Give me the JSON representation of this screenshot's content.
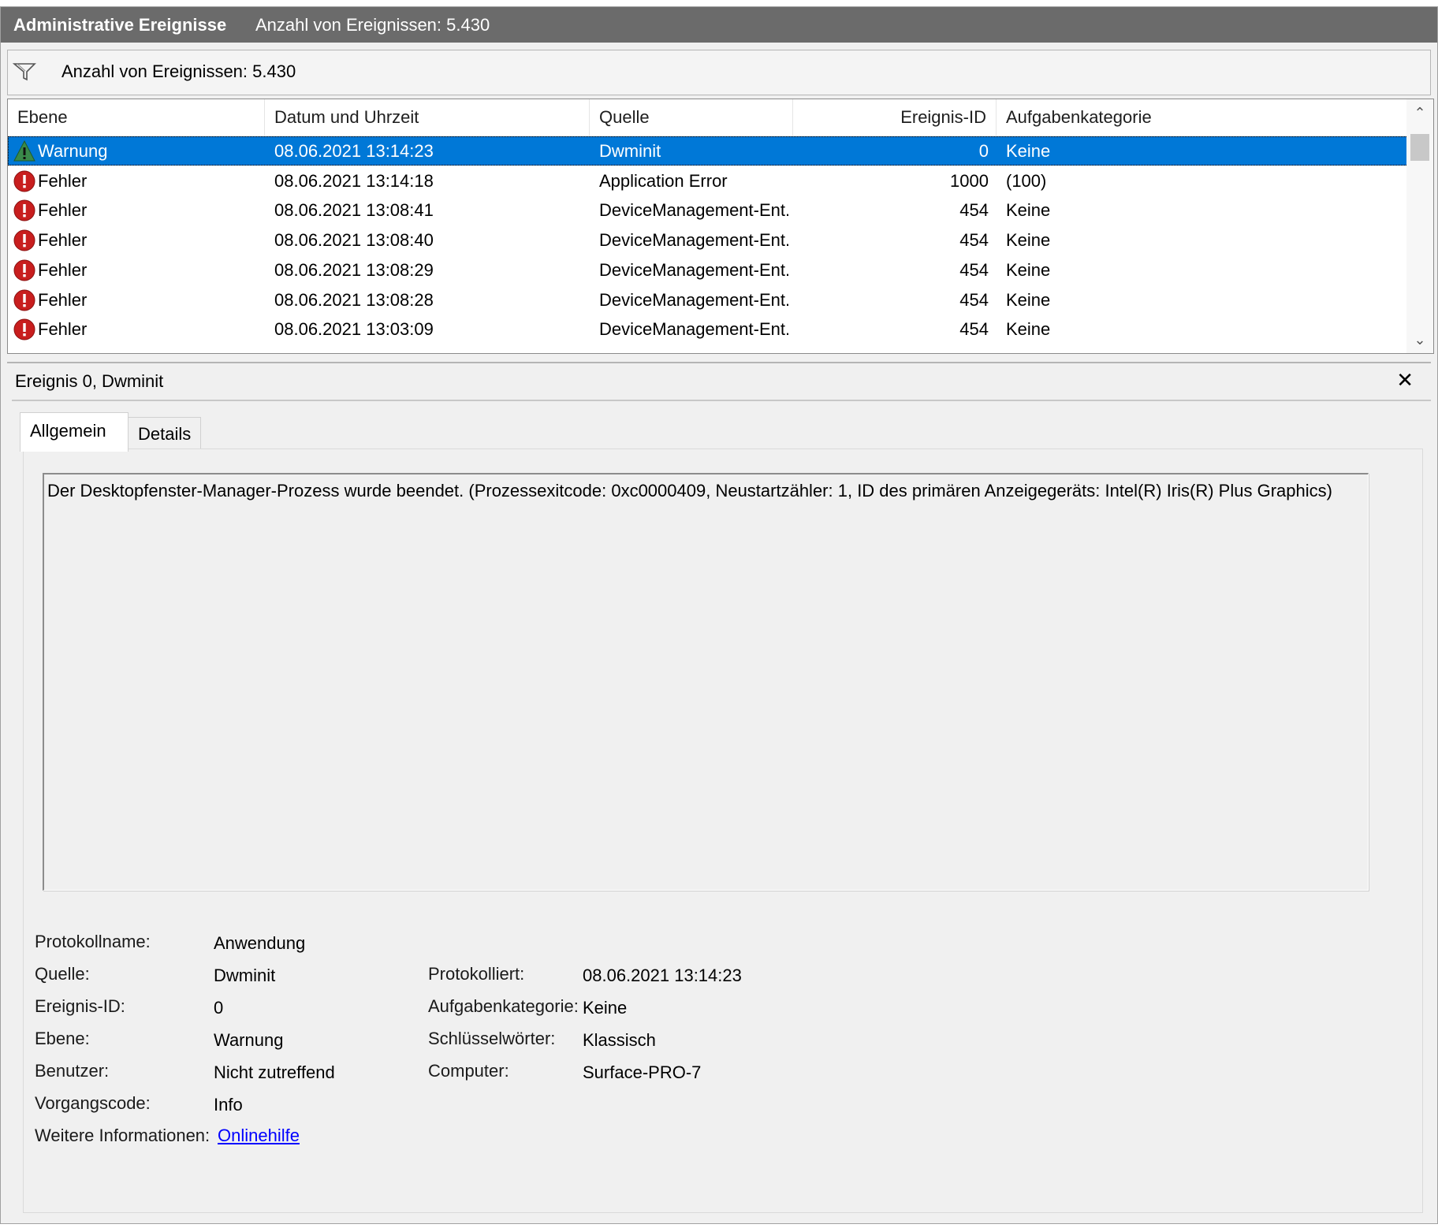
{
  "titlebar": {
    "title": "Administrative Ereignisse",
    "count": "Anzahl von Ereignissen: 5.430"
  },
  "filterbar": {
    "icon": "filter-funnel-icon",
    "text": "Anzahl von Ereignissen: 5.430"
  },
  "grid": {
    "columns": [
      "Ebene",
      "Datum und Uhrzeit",
      "Quelle",
      "Ereignis-ID",
      "Aufgabenkategorie"
    ],
    "rows": [
      {
        "level": "Warnung",
        "icon": "warning-icon",
        "datetime": "08.06.2021 13:14:23",
        "source": "Dwminit",
        "id": "0",
        "category": "Keine",
        "selected": true
      },
      {
        "level": "Fehler",
        "icon": "error-icon",
        "datetime": "08.06.2021 13:14:18",
        "source": "Application Error",
        "id": "1000",
        "category": "(100)",
        "selected": false
      },
      {
        "level": "Fehler",
        "icon": "error-icon",
        "datetime": "08.06.2021 13:08:41",
        "source": "DeviceManagement-Ent...",
        "id": "454",
        "category": "Keine",
        "selected": false
      },
      {
        "level": "Fehler",
        "icon": "error-icon",
        "datetime": "08.06.2021 13:08:40",
        "source": "DeviceManagement-Ent...",
        "id": "454",
        "category": "Keine",
        "selected": false
      },
      {
        "level": "Fehler",
        "icon": "error-icon",
        "datetime": "08.06.2021 13:08:29",
        "source": "DeviceManagement-Ent...",
        "id": "454",
        "category": "Keine",
        "selected": false
      },
      {
        "level": "Fehler",
        "icon": "error-icon",
        "datetime": "08.06.2021 13:08:28",
        "source": "DeviceManagement-Ent...",
        "id": "454",
        "category": "Keine",
        "selected": false
      },
      {
        "level": "Fehler",
        "icon": "error-icon",
        "datetime": "08.06.2021 13:03:09",
        "source": "DeviceManagement-Ent...",
        "id": "454",
        "category": "Keine",
        "selected": false
      }
    ]
  },
  "detail": {
    "title": "Ereignis 0, Dwminit",
    "close": "✕",
    "tabs": [
      "Allgemein",
      "Details"
    ],
    "message": "Der Desktopfenster-Manager-Prozess wurde beendet. (Prozessexitcode: 0xc0000409, Neustartzähler: 1, ID des primären Anzeigegeräts: Intel(R) Iris(R) Plus Graphics)",
    "fields": {
      "logname_label": "Protokollname:",
      "logname": "Anwendung",
      "source_label": "Quelle:",
      "source": "Dwminit",
      "logged_label": "Protokolliert:",
      "logged": "08.06.2021 13:14:23",
      "eventid_label": "Ereignis-ID:",
      "eventid": "0",
      "taskcat_label": "Aufgabenkategorie:",
      "taskcat": "Keine",
      "level_label": "Ebene:",
      "level": "Warnung",
      "keywords_label": "Schlüsselwörter:",
      "keywords": "Klassisch",
      "user_label": "Benutzer:",
      "user": "Nicht zutreffend",
      "computer_label": "Computer:",
      "computer": "Surface-PRO-7",
      "opcode_label": "Vorgangscode:",
      "opcode": "Info",
      "moreinfo_label": "Weitere Informationen:",
      "moreinfo_link": "Onlinehilfe"
    }
  },
  "colors": {
    "titlebar": "#6b6b6b",
    "selection": "#0078d7",
    "link": "#0000ff",
    "error": "#c81e1e",
    "warning": "#3a8a4a"
  }
}
